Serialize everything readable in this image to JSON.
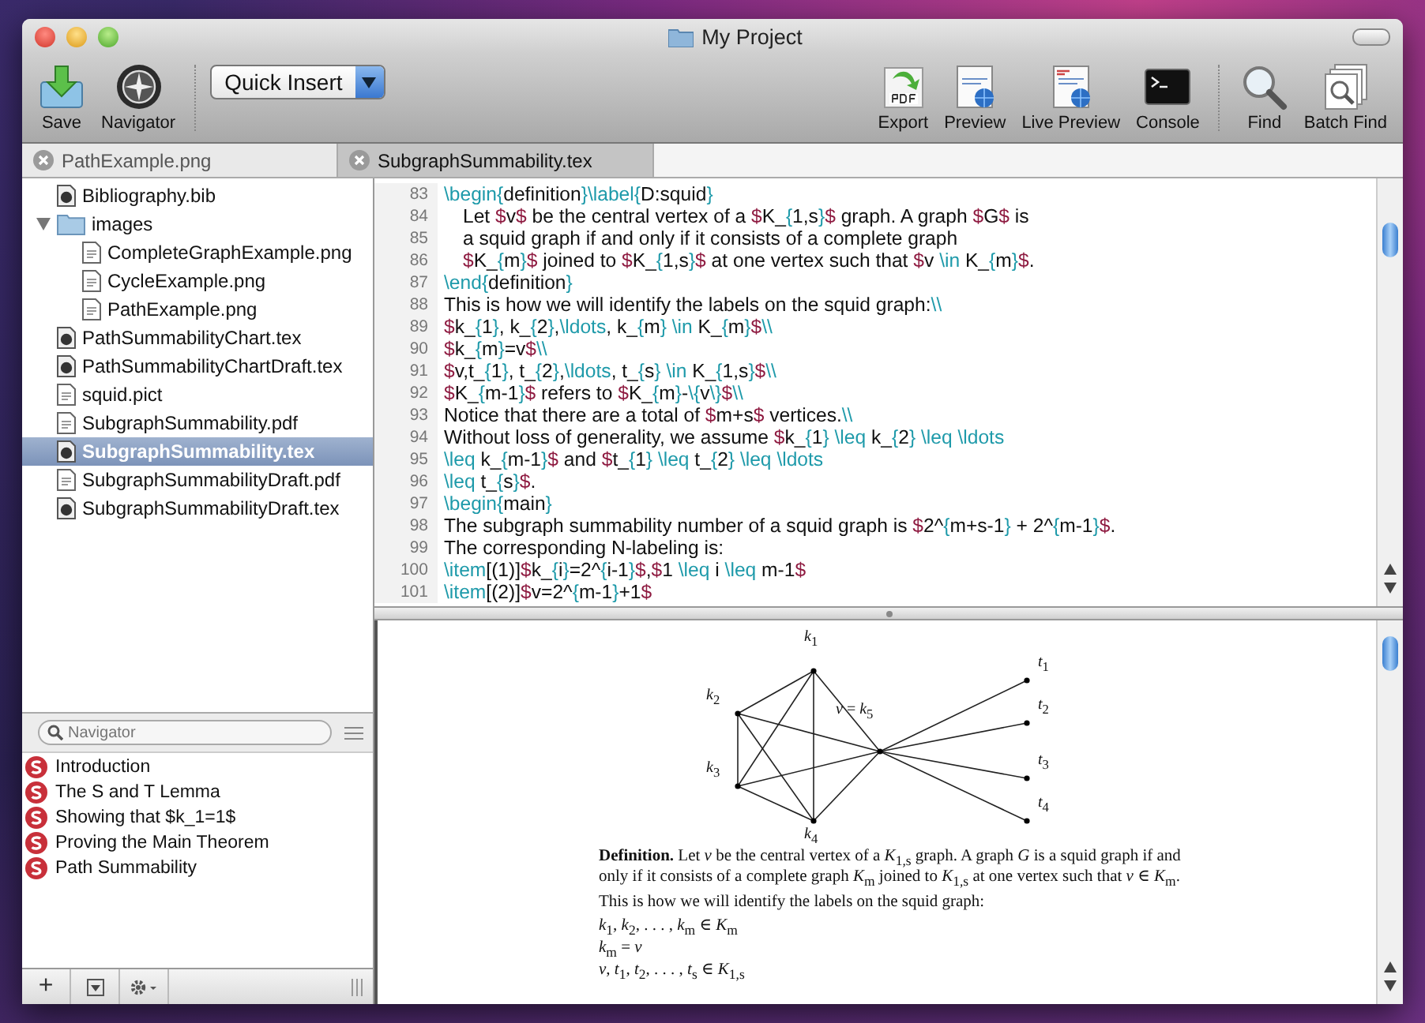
{
  "window": {
    "title": "My Project"
  },
  "toolbar": {
    "left": [
      {
        "kind": "save",
        "label": "Save"
      },
      {
        "kind": "compass",
        "label": "Navigator"
      }
    ],
    "quick_insert": {
      "label": "Quick Insert"
    },
    "right": [
      {
        "kind": "export",
        "label": "Export"
      },
      {
        "kind": "pdf",
        "label": "Preview"
      },
      {
        "kind": "live",
        "label": "Live Preview"
      },
      {
        "kind": "terminal",
        "label": "Console"
      },
      {
        "kind": "find",
        "label": "Find"
      },
      {
        "kind": "batch",
        "label": "Batch Find"
      }
    ]
  },
  "tabs": [
    {
      "label": "PathExample.png",
      "selected": false
    },
    {
      "label": "SubgraphSummability.tex",
      "selected": true
    }
  ],
  "files": [
    {
      "kind": "tex",
      "name": "Bibliography.bib",
      "selected": false
    },
    {
      "kind": "folder",
      "name": "images",
      "selected": false,
      "expanded": true,
      "children": [
        {
          "kind": "file",
          "name": "CompleteGraphExample.png",
          "selected": false
        },
        {
          "kind": "file",
          "name": "CycleExample.png",
          "selected": false
        },
        {
          "kind": "file",
          "name": "PathExample.png",
          "selected": false
        }
      ]
    },
    {
      "kind": "tex",
      "name": "PathSummabilityChart.tex",
      "selected": false
    },
    {
      "kind": "tex",
      "name": "PathSummabilityChartDraft.tex",
      "selected": false
    },
    {
      "kind": "file",
      "name": "squid.pict",
      "selected": false
    },
    {
      "kind": "file",
      "name": "SubgraphSummability.pdf",
      "selected": false
    },
    {
      "kind": "tex",
      "name": "SubgraphSummability.tex",
      "selected": true
    },
    {
      "kind": "file",
      "name": "SubgraphSummabilityDraft.pdf",
      "selected": false
    },
    {
      "kind": "tex",
      "name": "SubgraphSummabilityDraft.tex",
      "selected": false
    }
  ],
  "navigator": {
    "search": {
      "placeholder": "Navigator"
    },
    "items": [
      "Introduction",
      "The S and T Lemma",
      "Showing that $k_1=1$",
      "Proving the Main Theorem",
      "Path Summability"
    ],
    "bottom_buttons": [
      "+"
    ]
  },
  "editor": {
    "lines": [
      {
        "number": "83",
        "indented": false,
        "text": "\\begin{definition}\\label{D:squid}"
      },
      {
        "number": "84",
        "indented": true,
        "text": "Let $v$ be the central vertex of a $K_{1,s}$ graph. A graph $G$ is"
      },
      {
        "number": "85",
        "indented": true,
        "text": "a squid graph if and only if it consists of a complete graph"
      },
      {
        "number": "86",
        "indented": true,
        "text": "$K_{m}$ joined to $K_{1,s}$ at one vertex such that $v \\in K_{m}$."
      },
      {
        "number": "87",
        "indented": false,
        "text": "\\end{definition}"
      },
      {
        "number": "88",
        "indented": false,
        "text": "This is how we will identify the labels on the squid graph:\\\\"
      },
      {
        "number": "89",
        "indented": false,
        "text": "$k_{1}, k_{2},\\ldots, k_{m} \\in K_{m}$\\\\"
      },
      {
        "number": "90",
        "indented": false,
        "text": "$k_{m}=v$\\\\"
      },
      {
        "number": "91",
        "indented": false,
        "text": "$v,t_{1}, t_{2},\\ldots, t_{s} \\in K_{1,s}$\\\\"
      },
      {
        "number": "92",
        "indented": false,
        "text": "$K_{m-1}$ refers to $K_{m}-\\{v\\}$\\\\"
      },
      {
        "number": "93",
        "indented": false,
        "text": "Notice that there are a total of $m+s$ vertices.\\\\"
      },
      {
        "number": "94",
        "indented": false,
        "text": "Without loss of generality, we assume $k_{1} \\leq k_{2} \\leq \\ldots"
      },
      {
        "number": "95",
        "indented": false,
        "text": "\\leq k_{m-1}$ and $t_{1} \\leq t_{2} \\leq \\ldots"
      },
      {
        "number": "96",
        "indented": false,
        "text": "\\leq t_{s}$."
      },
      {
        "number": "97",
        "indented": false,
        "text": "\\begin{main}"
      },
      {
        "number": "98",
        "indented": false,
        "text": "The subgraph summability number of a squid graph is $2^{m+s-1} + 2^{m-1}$."
      },
      {
        "number": "99",
        "indented": false,
        "text": "The corresponding N-labeling is:"
      },
      {
        "number": "100",
        "indented": false,
        "text": "\\item[(1)]$k_{i}=2^{i-1}$,$1 \\leq i \\leq m-1$"
      },
      {
        "number": "101",
        "indented": false,
        "text": "\\item[(2)]$v=2^{m-1}+1$"
      }
    ]
  },
  "preview": {
    "graph_labels": [
      "*k*$_{1}$",
      "*k*$_{2}$",
      "*k*$_{3}$",
      "*k*$_{4}$",
      "*v* = *k*$_{5}$",
      "*t*$_{1}$",
      "*t*$_{2}$",
      "*t*$_{3}$",
      "*t*$_{4}$"
    ],
    "paragraphs": [
      "**Definition.** Let *v* be the central vertex of a *K*$_{1,s}$ graph.  A graph *G* is a squid graph if and only if it consists of a complete graph *K*$_{m}$ joined to *K*$_{1,s}$ at one vertex such that *v* ∈ *K*$_{m}$.",
      "This is how we will identify the labels on the squid graph:"
    ],
    "math_lines": [
      "*k*$_{1}$, *k*$_{2}$, . . . , *k*$_{m}$ ∈ *K*$_{m}$",
      "*k*$_{m}$ = *v*",
      "*v*, *t*$_{1}$, *t*$_{2}$, . . . , *t*$_{s}$ ∈ *K*$_{1,s}$"
    ]
  }
}
